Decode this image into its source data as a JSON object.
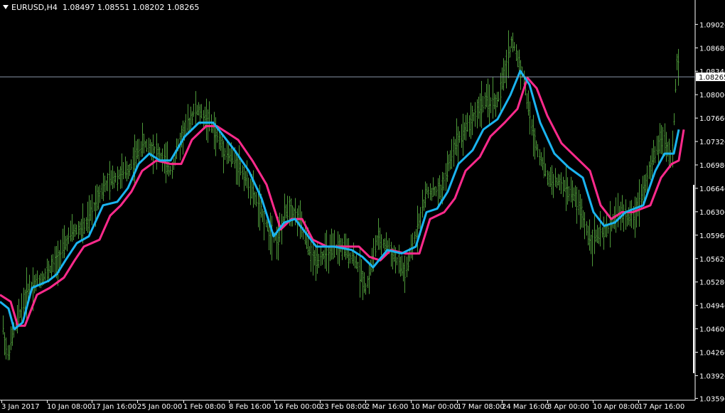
{
  "header": {
    "symbol": "EURUSD,H4",
    "ohlc": "1.08497 1.08551 1.08202 1.08265"
  },
  "colors": {
    "background": "#000000",
    "bars": "#4e9a3a",
    "ma_fast": "#1ab4f0",
    "ma_slow": "#ff2a8c",
    "axis": "#ffffff",
    "price_line": "#8a96a8",
    "tag_bg": "#ffffff",
    "tag_text": "#000000"
  },
  "chart_data": {
    "type": "line",
    "ylim": [
      1.0359,
      1.0936
    ],
    "y_ticks": [
      "1.09026",
      "1.08686",
      "1.08346",
      "1.08006",
      "1.07666",
      "1.07326",
      "1.06986",
      "1.06646",
      "1.06306",
      "1.05966",
      "1.05626",
      "1.05286",
      "1.04946",
      "1.04606",
      "1.04266",
      "1.03926",
      "1.03596"
    ],
    "current_price": "1.08265",
    "x_ticks": [
      "3 Jan 2017",
      "10 Jan 08:00",
      "17 Jan 16:00",
      "25 Jan 00:00",
      "1 Feb 08:00",
      "8 Feb 16:00",
      "16 Feb 00:00",
      "23 Feb 08:00",
      "2 Mar 16:00",
      "10 Mar 00:00",
      "17 Mar 08:00",
      "24 Mar 16:00",
      "3 Apr 00:00",
      "10 Apr 08:00",
      "17 Apr 16:00"
    ],
    "price_path": [
      [
        0,
        1.049
      ],
      [
        10,
        1.042
      ],
      [
        20,
        1.046
      ],
      [
        40,
        1.052
      ],
      [
        60,
        1.0535
      ],
      [
        80,
        1.056
      ],
      [
        100,
        1.06
      ],
      [
        120,
        1.061
      ],
      [
        140,
        1.066
      ],
      [
        160,
        1.068
      ],
      [
        180,
        1.069
      ],
      [
        200,
        1.073
      ],
      [
        220,
        1.072
      ],
      [
        240,
        1.069
      ],
      [
        255,
        1.074
      ],
      [
        275,
        1.078
      ],
      [
        295,
        1.076
      ],
      [
        315,
        1.072
      ],
      [
        335,
        1.07
      ],
      [
        355,
        1.066
      ],
      [
        375,
        1.061
      ],
      [
        390,
        1.059
      ],
      [
        405,
        1.064
      ],
      [
        420,
        1.062
      ],
      [
        440,
        1.056
      ],
      [
        460,
        1.057
      ],
      [
        480,
        1.058
      ],
      [
        500,
        1.056
      ],
      [
        515,
        1.052
      ],
      [
        530,
        1.059
      ],
      [
        545,
        1.058
      ],
      [
        570,
        1.054
      ],
      [
        585,
        1.06
      ],
      [
        600,
        1.066
      ],
      [
        620,
        1.066
      ],
      [
        640,
        1.073
      ],
      [
        660,
        1.076
      ],
      [
        680,
        1.079
      ],
      [
        700,
        1.079
      ],
      [
        720,
        1.088
      ],
      [
        735,
        1.083
      ],
      [
        750,
        1.074
      ],
      [
        770,
        1.068
      ],
      [
        790,
        1.067
      ],
      [
        810,
        1.065
      ],
      [
        830,
        1.059
      ],
      [
        850,
        1.06
      ],
      [
        870,
        1.063
      ],
      [
        890,
        1.062
      ],
      [
        910,
        1.068
      ],
      [
        930,
        1.074
      ],
      [
        945,
        1.071
      ],
      [
        952,
        1.085
      ],
      [
        956,
        1.0826
      ]
    ],
    "series": [
      {
        "values": [
          [
            0,
            1.05
          ],
          [
            12,
            1.049
          ],
          [
            20,
            1.046
          ],
          [
            32,
            1.047
          ],
          [
            45,
            1.052
          ],
          [
            68,
            1.053
          ],
          [
            80,
            1.054
          ],
          [
            92,
            1.056
          ],
          [
            108,
            1.0585
          ],
          [
            125,
            1.0595
          ],
          [
            145,
            1.064
          ],
          [
            165,
            1.0645
          ],
          [
            180,
            1.0665
          ],
          [
            195,
            1.07
          ],
          [
            210,
            1.0715
          ],
          [
            225,
            1.0705
          ],
          [
            240,
            1.0705
          ],
          [
            260,
            1.074
          ],
          [
            280,
            1.076
          ],
          [
            300,
            1.076
          ],
          [
            315,
            1.074
          ],
          [
            330,
            1.072
          ],
          [
            350,
            1.069
          ],
          [
            368,
            1.065
          ],
          [
            385,
            1.0595
          ],
          [
            400,
            1.0615
          ],
          [
            415,
            1.062
          ],
          [
            430,
            1.06
          ],
          [
            445,
            1.058
          ],
          [
            470,
            1.058
          ],
          [
            495,
            1.0575
          ],
          [
            510,
            1.0565
          ],
          [
            525,
            1.055
          ],
          [
            545,
            1.0575
          ],
          [
            565,
            1.057
          ],
          [
            585,
            1.058
          ],
          [
            600,
            1.063
          ],
          [
            615,
            1.0635
          ],
          [
            630,
            1.066
          ],
          [
            645,
            1.07
          ],
          [
            665,
            1.072
          ],
          [
            680,
            1.075
          ],
          [
            700,
            1.0765
          ],
          [
            718,
            1.08
          ],
          [
            732,
            1.0835
          ],
          [
            745,
            1.0815
          ],
          [
            760,
            1.076
          ],
          [
            780,
            1.0715
          ],
          [
            800,
            1.0695
          ],
          [
            820,
            1.068
          ],
          [
            835,
            1.063
          ],
          [
            850,
            1.061
          ],
          [
            865,
            1.0615
          ],
          [
            880,
            1.063
          ],
          [
            905,
            1.064
          ],
          [
            922,
            1.069
          ],
          [
            935,
            1.0715
          ],
          [
            948,
            1.0715
          ],
          [
            955,
            1.075
          ]
        ]
      },
      {
        "values": [
          [
            0,
            1.051
          ],
          [
            15,
            1.05
          ],
          [
            25,
            1.0465
          ],
          [
            35,
            1.0465
          ],
          [
            52,
            1.051
          ],
          [
            70,
            1.052
          ],
          [
            90,
            1.0535
          ],
          [
            105,
            1.056
          ],
          [
            118,
            1.058
          ],
          [
            140,
            1.059
          ],
          [
            155,
            1.0625
          ],
          [
            170,
            1.064
          ],
          [
            185,
            1.066
          ],
          [
            200,
            1.069
          ],
          [
            220,
            1.0705
          ],
          [
            240,
            1.07
          ],
          [
            255,
            1.07
          ],
          [
            270,
            1.0735
          ],
          [
            290,
            1.0755
          ],
          [
            305,
            1.0755
          ],
          [
            320,
            1.0745
          ],
          [
            335,
            1.0735
          ],
          [
            355,
            1.0705
          ],
          [
            375,
            1.067
          ],
          [
            395,
            1.0605
          ],
          [
            410,
            1.062
          ],
          [
            425,
            1.062
          ],
          [
            440,
            1.059
          ],
          [
            460,
            1.058
          ],
          [
            490,
            1.058
          ],
          [
            505,
            1.058
          ],
          [
            520,
            1.0565
          ],
          [
            535,
            1.056
          ],
          [
            550,
            1.0575
          ],
          [
            570,
            1.057
          ],
          [
            590,
            1.057
          ],
          [
            605,
            1.062
          ],
          [
            625,
            1.063
          ],
          [
            640,
            1.065
          ],
          [
            655,
            1.069
          ],
          [
            675,
            1.071
          ],
          [
            690,
            1.074
          ],
          [
            710,
            1.076
          ],
          [
            728,
            1.078
          ],
          [
            742,
            1.0825
          ],
          [
            755,
            1.081
          ],
          [
            770,
            1.077
          ],
          [
            790,
            1.073
          ],
          [
            810,
            1.071
          ],
          [
            830,
            1.069
          ],
          [
            845,
            1.064
          ],
          [
            860,
            1.062
          ],
          [
            875,
            1.063
          ],
          [
            890,
            1.063
          ],
          [
            915,
            1.064
          ],
          [
            930,
            1.068
          ],
          [
            945,
            1.07
          ],
          [
            955,
            1.0705
          ],
          [
            962,
            1.075
          ]
        ]
      }
    ],
    "grid": false
  }
}
